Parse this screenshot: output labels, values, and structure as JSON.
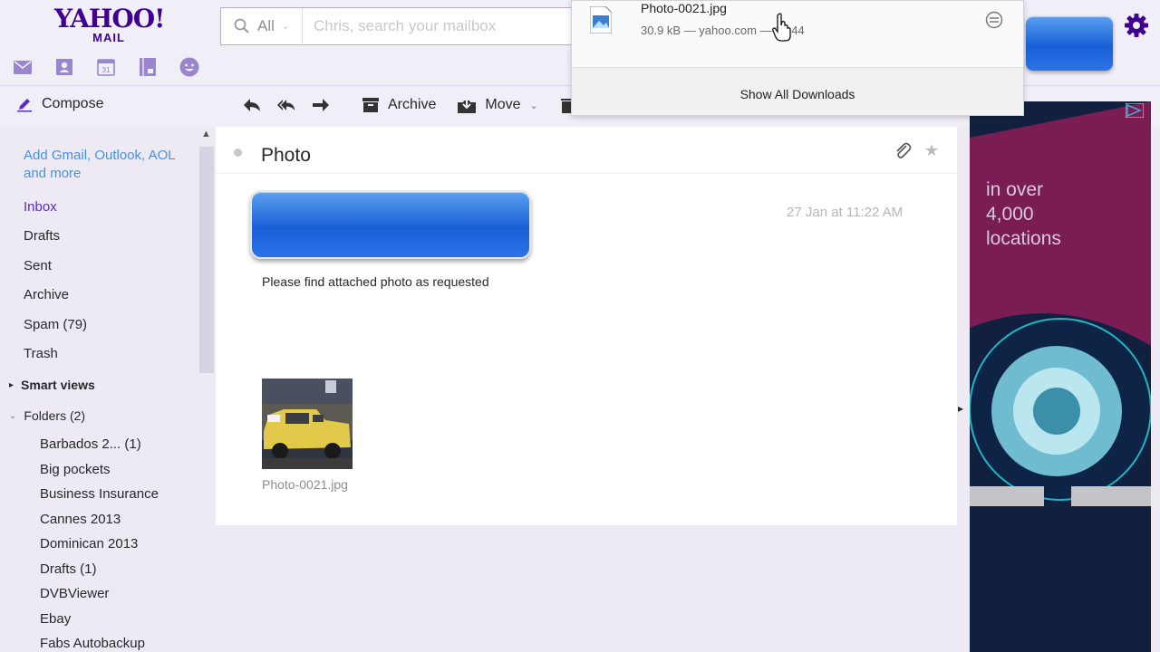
{
  "logo": {
    "line1": "YAHOO!",
    "line2": "MAIL"
  },
  "apps": [
    "mail-icon",
    "contacts-icon",
    "calendar-icon",
    "notepad-icon",
    "messenger-icon"
  ],
  "calendar_day": "31",
  "search": {
    "scope": "All",
    "placeholder": "Chris, search your mailbox"
  },
  "toolbar": {
    "compose": "Compose",
    "archive": "Archive",
    "move": "Move"
  },
  "sidebar": {
    "add_accounts": "Add Gmail, Outlook, AOL and more",
    "folders": [
      {
        "label": "Inbox"
      },
      {
        "label": "Drafts"
      },
      {
        "label": "Sent"
      },
      {
        "label": "Archive"
      },
      {
        "label": "Spam (79)"
      },
      {
        "label": "Trash"
      }
    ],
    "smart_views": "Smart views",
    "folders_header": "Folders (2)",
    "subfolders": [
      {
        "label": "Barbados 2...  (1)"
      },
      {
        "label": "Big pockets"
      },
      {
        "label": "Business Insurance"
      },
      {
        "label": "Cannes 2013"
      },
      {
        "label": "Dominican 2013"
      },
      {
        "label": "Drafts  (1)"
      },
      {
        "label": "DVBViewer"
      },
      {
        "label": "Ebay"
      },
      {
        "label": "Fabs Autobackup"
      }
    ]
  },
  "message": {
    "subject": "Photo",
    "date": "27 Jan at 11:22 AM",
    "body": "Please find attached photo as requested",
    "attachment": "Photo-0021.jpg"
  },
  "downloads": {
    "file_name": "Photo-0021.jpg",
    "meta": "30.9 kB — yahoo.com — 17:44",
    "show_all": "Show All Downloads"
  },
  "ad": {
    "text": "in over 4,000 locations"
  },
  "colors": {
    "brand": "#400090",
    "link": "#4a90e2",
    "accent_blue": "#1a5fd6"
  }
}
